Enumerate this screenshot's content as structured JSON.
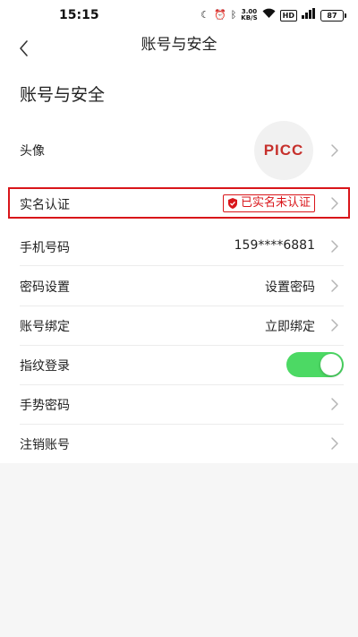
{
  "status_bar": {
    "time": "15:15",
    "network_speed_value": "3.00",
    "network_speed_unit": "KB/S",
    "hd_label": "HD",
    "signal_label": "5G",
    "battery_level": "87"
  },
  "header": {
    "title": "账号与安全"
  },
  "section": {
    "title": "账号与安全"
  },
  "avatar": {
    "logo_text": "PICC"
  },
  "rows": {
    "avatar": {
      "label": "头像"
    },
    "real_name": {
      "label": "实名认证",
      "badge_text": "已实名未认证"
    },
    "phone": {
      "label": "手机号码",
      "value": "159****6881"
    },
    "password": {
      "label": "密码设置",
      "value": "设置密码"
    },
    "binding": {
      "label": "账号绑定",
      "value": "立即绑定"
    },
    "fingerprint": {
      "label": "指纹登录",
      "enabled": true
    },
    "gesture": {
      "label": "手势密码"
    },
    "cancel": {
      "label": "注销账号"
    }
  },
  "colors": {
    "accent_red": "#d9151a",
    "toggle_on": "#4cd964",
    "brand_red": "#c6302c"
  }
}
